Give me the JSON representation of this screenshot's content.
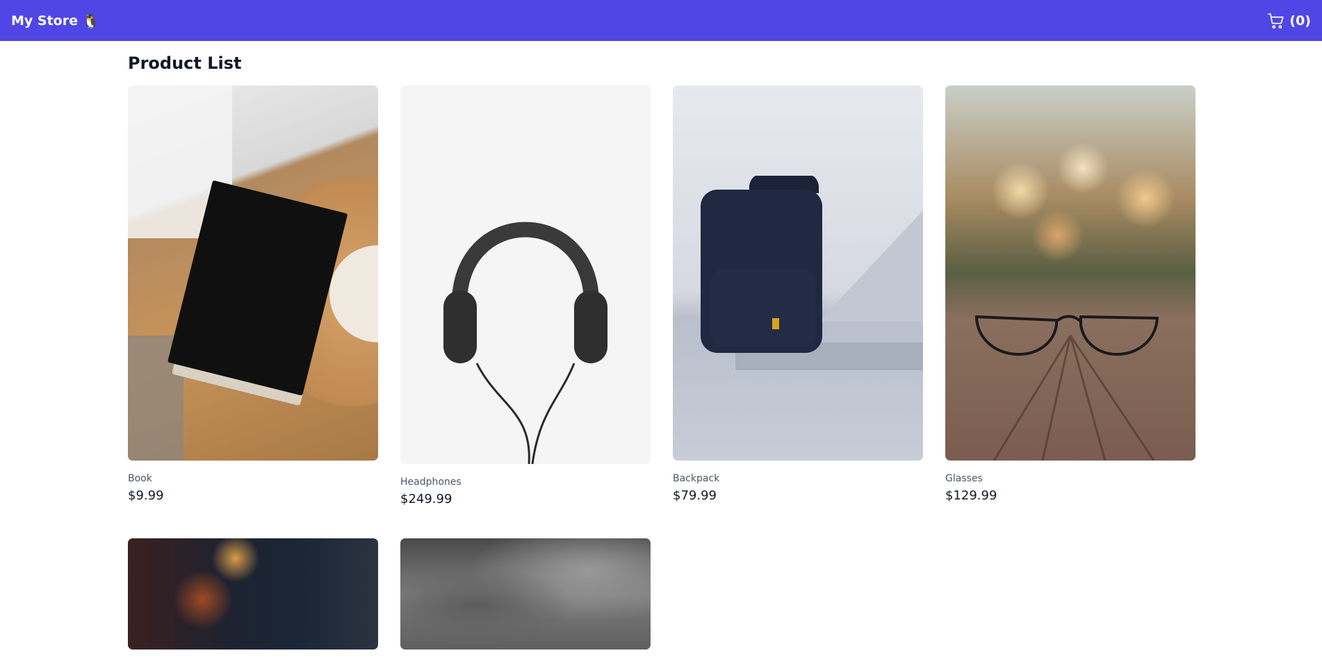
{
  "navbar": {
    "brand": "My Store",
    "brand_emoji": "🐧",
    "cart_count_label": "(0)",
    "background": "#4f46e5"
  },
  "main": {
    "title": "Product List",
    "products": [
      {
        "name": "Book",
        "price": "$9.99"
      },
      {
        "name": "Headphones",
        "price": "$249.99"
      },
      {
        "name": "Backpack",
        "price": "$79.99"
      },
      {
        "name": "Glasses",
        "price": "$129.99"
      },
      {
        "name": "",
        "price": ""
      },
      {
        "name": "",
        "price": ""
      }
    ]
  },
  "icons": {
    "cart": "shopping-cart-icon"
  }
}
